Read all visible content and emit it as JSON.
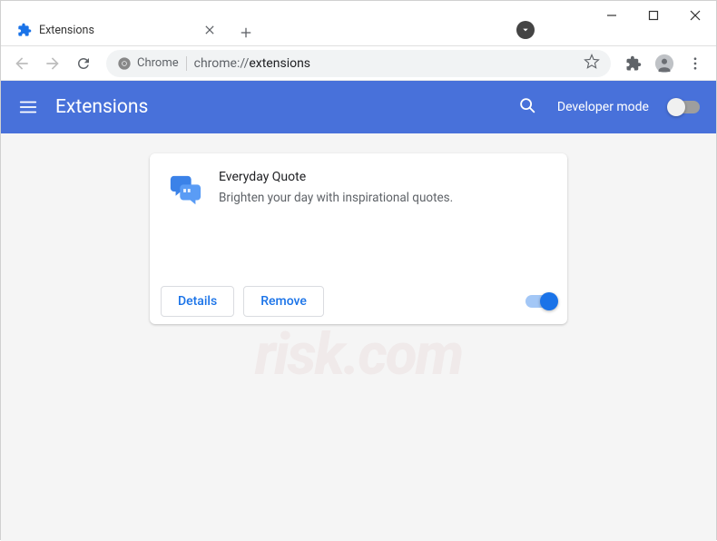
{
  "window": {
    "tab_title": "Extensions"
  },
  "omnibox": {
    "chip_text": "Chrome",
    "url_scheme": "chrome://",
    "url_path": "extensions"
  },
  "header": {
    "title": "Extensions",
    "dev_mode_label": "Developer mode"
  },
  "extension": {
    "name": "Everyday Quote",
    "description": "Brighten your day with inspirational quotes.",
    "details_label": "Details",
    "remove_label": "Remove",
    "enabled": true
  },
  "colors": {
    "header_bg": "#4871da",
    "accent": "#1a73e8"
  }
}
